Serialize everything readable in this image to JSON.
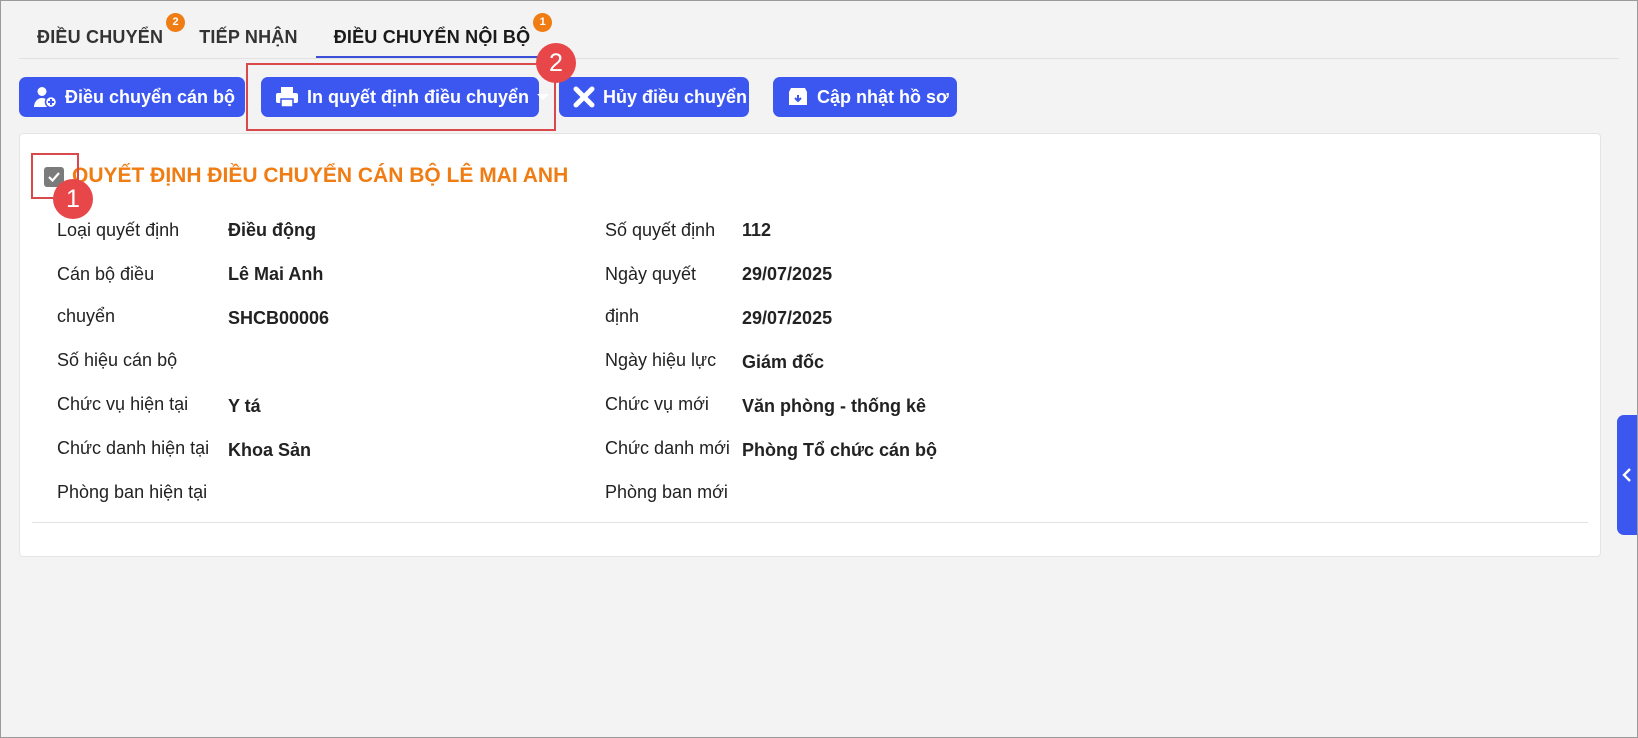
{
  "tabs": [
    {
      "label": "ĐIỀU CHUYỂN",
      "badge": "2",
      "active": false
    },
    {
      "label": "TIẾP NHẬN",
      "badge": "",
      "active": false
    },
    {
      "label": "ĐIỀU CHUYỂN NỘI BỘ",
      "badge": "1",
      "active": true
    }
  ],
  "toolbar": {
    "transfer_label": "Điều chuyển cán bộ",
    "print_label": "In quyết định điều chuyển",
    "cancel_label": "Hủy điều chuyển",
    "update_label": "Cập nhật hồ sơ"
  },
  "markers": {
    "one": "1",
    "two": "2"
  },
  "decision": {
    "title": "QUYẾT ĐỊNH ĐIỀU CHUYỂN CÁN BỘ LÊ MAI ANH",
    "left_labels": {
      "type": "Loại quyết định",
      "staff_line1": "Cán bộ điều",
      "staff_line2": "chuyển",
      "staff_code": "Số hiệu cán bộ",
      "cur_position": "Chức vụ hiện tại",
      "cur_title": "Chức danh hiện tại",
      "cur_dept": "Phòng ban hiện tại"
    },
    "left_values": {
      "type": "Điều động",
      "staff": "Lê Mai Anh",
      "staff_code": "SHCB00006",
      "cur_position": "Y tá",
      "cur_title": "Khoa Sản"
    },
    "right_labels": {
      "number": "Số quyết định",
      "date_line1": "Ngày quyết",
      "date_line2": "định",
      "effective": "Ngày hiệu lực",
      "new_position": "Chức vụ mới",
      "new_title": "Chức danh mới",
      "new_dept": "Phòng ban mới"
    },
    "right_values": {
      "number": "112",
      "date": "29/07/2025",
      "effective": "29/07/2025",
      "new_position": "Giám đốc",
      "new_title": "Văn phòng - thống kê",
      "new_dept": "Phòng Tổ chức cán bộ"
    }
  },
  "colors": {
    "primary": "#3b57f0",
    "accent": "#f07d14",
    "highlight": "#e8474a"
  },
  "icons": {
    "transfer": "user-plus-icon",
    "print": "printer-icon",
    "cancel": "close-icon",
    "update": "archive-download-icon",
    "side": "chevron-left-icon"
  }
}
